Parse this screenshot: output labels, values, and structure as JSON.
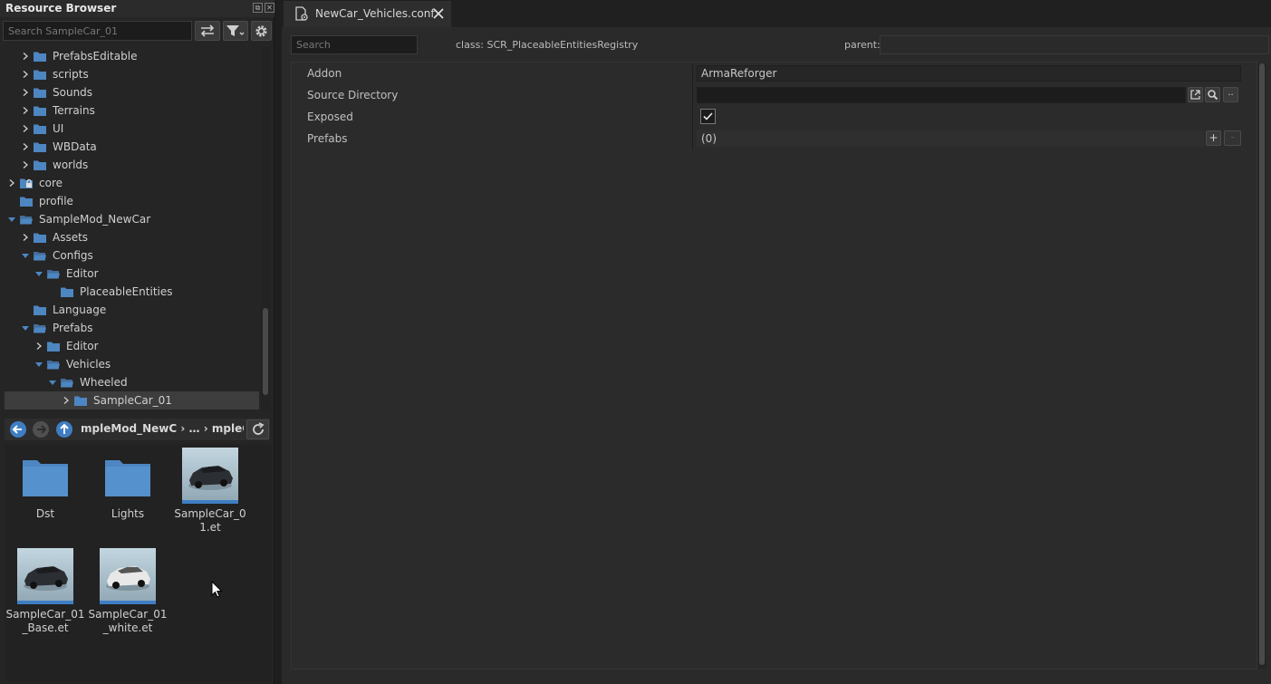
{
  "resource_browser": {
    "title": "Resource Browser",
    "search_placeholder": "Search SampleCar_01",
    "tree": [
      {
        "label": "PrefabsEditable",
        "expanded": false
      },
      {
        "label": "scripts",
        "expanded": false
      },
      {
        "label": "Sounds",
        "expanded": false
      },
      {
        "label": "Terrains",
        "expanded": false
      },
      {
        "label": "UI",
        "expanded": false
      },
      {
        "label": "WBData",
        "expanded": false
      },
      {
        "label": "worlds",
        "expanded": false
      },
      {
        "label": "core",
        "expanded": false,
        "locked": true
      },
      {
        "label": "profile"
      },
      {
        "label": "SampleMod_NewCar",
        "expanded": true
      },
      {
        "label": "Assets",
        "expanded": false
      },
      {
        "label": "Configs",
        "expanded": true
      },
      {
        "label": "Editor",
        "expanded": true
      },
      {
        "label": "PlaceableEntities"
      },
      {
        "label": "Language"
      },
      {
        "label": "Prefabs",
        "expanded": true
      },
      {
        "label": "Editor",
        "expanded": false
      },
      {
        "label": "Vehicles",
        "expanded": true
      },
      {
        "label": "Wheeled",
        "expanded": true
      },
      {
        "label": "SampleCar_01",
        "expanded": false,
        "selected": true
      }
    ],
    "path": {
      "segment_1": "mpleMod_NewC",
      "ellipsis": "…",
      "segment_2": "mpleCar_"
    },
    "files": [
      {
        "label": "Dst",
        "kind": "folder"
      },
      {
        "label": "Lights",
        "kind": "folder"
      },
      {
        "label": "SampleCar_01.et",
        "kind": "prefab-dark"
      },
      {
        "label": "SampleCar_01_Base.et",
        "kind": "prefab-dark"
      },
      {
        "label": "SampleCar_01_white.et",
        "kind": "prefab-white"
      }
    ]
  },
  "editor": {
    "tab_label": "NewCar_Vehicles.conf",
    "search_placeholder": "Search",
    "class_label": "class: SCR_PlaceableEntitiesRegistry",
    "parent_label": "parent:",
    "parent_value": "",
    "properties": [
      {
        "name": "Addon",
        "value": "ArmaReforger"
      },
      {
        "name": "Source Directory",
        "value": ""
      },
      {
        "name": "Exposed",
        "checked": true
      },
      {
        "name": "Prefabs",
        "value": "(0)"
      }
    ],
    "buttons": {
      "browse_dots": "..",
      "add": "+",
      "remove": "-"
    }
  },
  "colors": {
    "folder": "#4d86c1",
    "accent": "#3f7ec4"
  }
}
